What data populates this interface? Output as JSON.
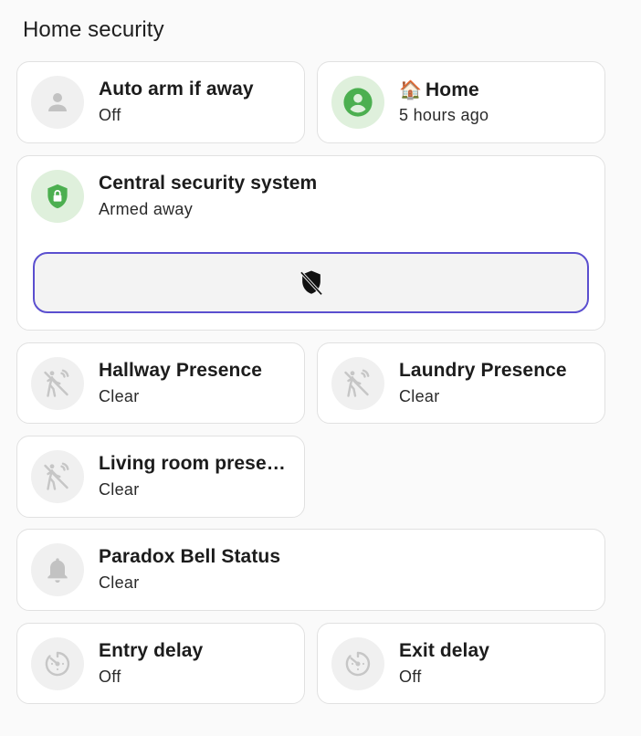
{
  "section": {
    "title": "Home security"
  },
  "colors": {
    "accent": "#5b4fcf",
    "green": "#4caf50",
    "icon_gray": "#c2c2c2"
  },
  "cards": {
    "auto_arm": {
      "name": "Auto arm if away",
      "state": "Off",
      "icon": "account-icon"
    },
    "home": {
      "emoji": "🏠",
      "name": "Home",
      "state": "5 hours ago",
      "icon": "person-circle-icon"
    },
    "central": {
      "name": "Central security system",
      "state": "Armed away",
      "icon": "shield-lock-icon",
      "action_icon": "shield-off-icon"
    },
    "hallway": {
      "name": "Hallway Presence",
      "state": "Clear",
      "icon": "motion-sensor-off-icon"
    },
    "laundry": {
      "name": "Laundry Presence",
      "state": "Clear",
      "icon": "motion-sensor-off-icon"
    },
    "living": {
      "name": "Living room presence",
      "state": "Clear",
      "icon": "motion-sensor-off-icon"
    },
    "bell": {
      "name": "Paradox Bell Status",
      "state": "Clear",
      "icon": "bell-icon"
    },
    "entry": {
      "name": "Entry delay",
      "state": "Off",
      "icon": "timer-icon"
    },
    "exit": {
      "name": "Exit delay",
      "state": "Off",
      "icon": "timer-icon"
    }
  }
}
